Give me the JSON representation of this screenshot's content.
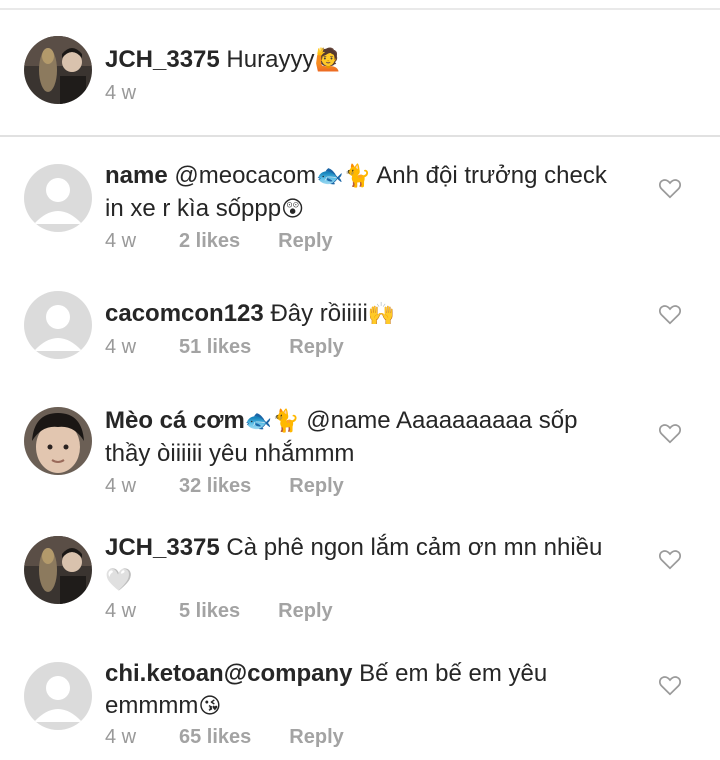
{
  "caption": {
    "username": "JCH_3375",
    "text": "Hurayyy",
    "emoji": "🙋",
    "time": "4 w"
  },
  "comments": [
    {
      "username": "name",
      "text_1": "@meocacom",
      "emoji_1": "🐟🐈",
      "text_2": "Anh đội trưởng check in xe r kìa sốppp",
      "emoji_2": "😲",
      "time": "4 w",
      "likes": "2 likes",
      "reply": "Reply",
      "avatar": "default"
    },
    {
      "username": "cacomcon123",
      "text_1": "Đây rồiiiii",
      "emoji_1": "🙌",
      "time": "4 w",
      "likes": "51 likes",
      "reply": "Reply",
      "avatar": "default"
    },
    {
      "username": "Mèo cá cơm",
      "username_emoji": "🐟🐈",
      "text_1": "@name Aaaaaaaaaa sốp thầy òiiiiii yêu nhắmmm",
      "time": "4 w",
      "likes": "32 likes",
      "reply": "Reply",
      "avatar": "photo-face"
    },
    {
      "username": "JCH_3375",
      "text_1": "Cà phê ngon lắm cảm ơn mn nhiều",
      "emoji_1": "🤍",
      "time": "4 w",
      "likes": "5 likes",
      "reply": "Reply",
      "avatar": "photo-trophy"
    },
    {
      "username": "chi.ketoan@company",
      "text_1": "Bế em bế em yêu emmmm",
      "emoji_1": "😘",
      "time": "4 w",
      "likes": "65 likes",
      "reply": "Reply",
      "avatar": "default"
    }
  ],
  "icons": {
    "like": "heart-outline-icon",
    "avatar_default": "default-avatar-icon"
  },
  "colors": {
    "text": "#262626",
    "meta": "#999999",
    "divider": "#e1e1e1",
    "avatar_default": "#dbdbdb"
  }
}
